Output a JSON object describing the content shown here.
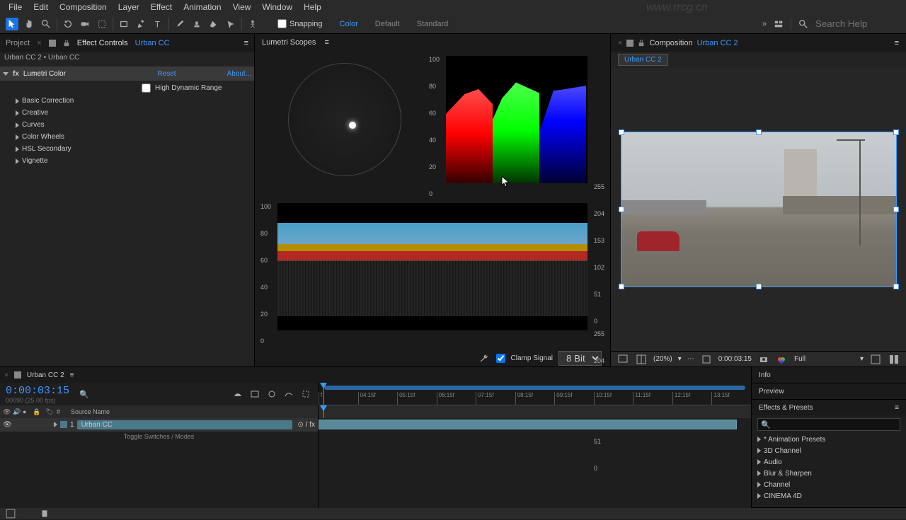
{
  "menu": [
    "File",
    "Edit",
    "Composition",
    "Layer",
    "Effect",
    "Animation",
    "View",
    "Window",
    "Help"
  ],
  "toolbar": {
    "snapping": "Snapping",
    "workspaces": {
      "color": "Color",
      "default": "Default",
      "standard": "Standard"
    },
    "search_placeholder": "Search Help"
  },
  "left": {
    "tabs": {
      "project": "Project",
      "effect_controls": "Effect Controls",
      "effect_target": "Urban CC"
    },
    "breadcrumb": "Urban CC 2 • Urban CC",
    "effect_name": "Lumetri Color",
    "reset": "Reset",
    "about": "About...",
    "hdr": "High Dynamic Range",
    "sections": [
      "Basic Correction",
      "Creative",
      "Curves",
      "Color Wheels",
      "HSL Secondary",
      "Vignette"
    ]
  },
  "scopes": {
    "title": "Lumetri Scopes",
    "parade_left": [
      "100",
      "80",
      "60",
      "40",
      "20",
      "0"
    ],
    "parade_right": [
      "255",
      "204",
      "153",
      "102",
      "51",
      "0"
    ],
    "clamp": "Clamp Signal",
    "bit_depth": "8 Bit"
  },
  "comp": {
    "panel_label": "Composition",
    "name": "Urban CC 2",
    "tab": "Urban CC 2",
    "footer": {
      "zoom": "(20%)",
      "time": "0:00:03:15",
      "res": "Full"
    }
  },
  "timeline": {
    "tab": "Urban CC 2",
    "timecode": "0:00:03:15",
    "fps": "00090 (25.00 fps)",
    "source_name_header": "Source Name",
    "layer_num": "1",
    "layer_name": "Urban CC",
    "toggle": "Toggle Switches / Modes",
    "ruler": [
      "f",
      "04:15f",
      "05:15f",
      "06:15f",
      "07:15f",
      "08:15f",
      "09:15f",
      "10:15f",
      "11:15f",
      "12:15f",
      "13:15f"
    ]
  },
  "side": {
    "info": "Info",
    "preview": "Preview",
    "effects": "Effects & Presets",
    "presets": [
      "* Animation Presets",
      "3D Channel",
      "Audio",
      "Blur & Sharpen",
      "Channel",
      "CINEMA 4D"
    ]
  },
  "chart_data": [
    {
      "type": "area",
      "name": "RGB Parade",
      "channels": [
        "R",
        "G",
        "B"
      ],
      "ylim_ire": [
        0,
        100
      ],
      "ylim_8bit": [
        0,
        255
      ],
      "estimated_ranges_ire": {
        "R": [
          10,
          78
        ],
        "G": [
          8,
          84
        ],
        "B": [
          5,
          80
        ]
      }
    },
    {
      "type": "area",
      "name": "Waveform (RGB overlay)",
      "ylim_ire": [
        0,
        100
      ],
      "ylim_8bit": [
        0,
        255
      ],
      "notes": "Sky band ~70-82 IRE, midtones ~40-65, shadows ~5-20"
    }
  ]
}
